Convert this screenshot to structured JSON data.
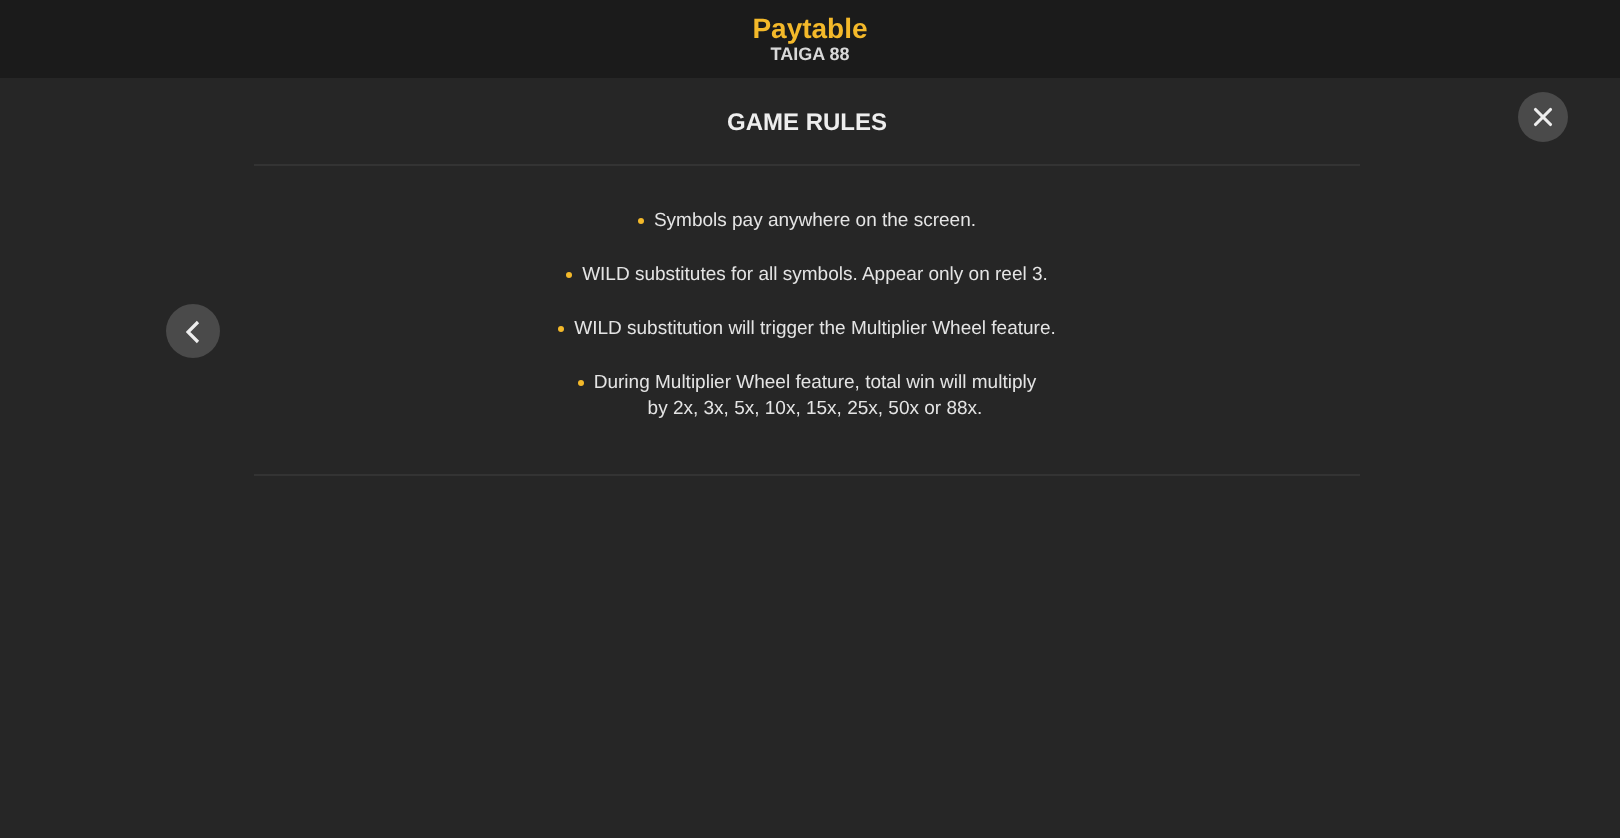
{
  "header": {
    "title": "Paytable",
    "subtitle": "TAIGA 88"
  },
  "section": {
    "title": "GAME RULES"
  },
  "rules": [
    {
      "lines": [
        "Symbols pay anywhere on the screen."
      ]
    },
    {
      "lines": [
        "WILD substitutes for all symbols. Appear only on reel 3."
      ]
    },
    {
      "lines": [
        "WILD substitution will trigger the Multiplier Wheel feature."
      ]
    },
    {
      "lines": [
        "During Multiplier Wheel feature, total win will multiply",
        "by 2x, 3x, 5x, 10x, 15x, 25x, 50x or 88x."
      ]
    }
  ]
}
